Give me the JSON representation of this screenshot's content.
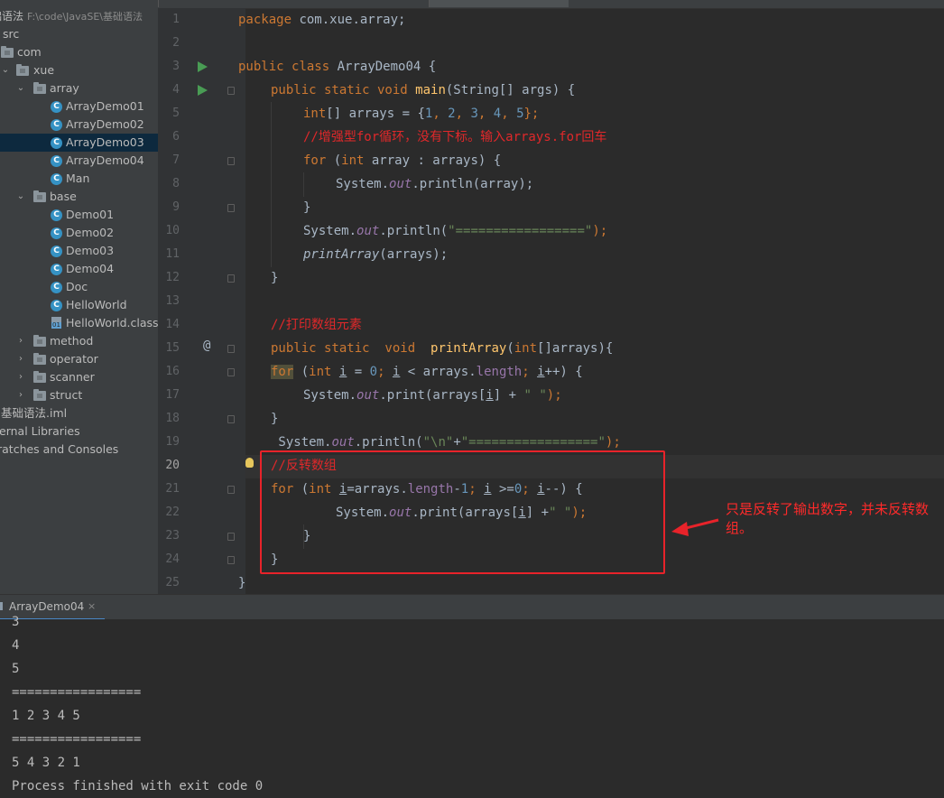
{
  "sidebar": {
    "root_name": "础语法",
    "root_path": "F:\\code\\JavaSE\\基础语法",
    "items": [
      {
        "label": "src",
        "kind": "text"
      },
      {
        "label": "com",
        "kind": "folder"
      },
      {
        "label": "xue",
        "kind": "folder",
        "expanded": true
      },
      {
        "label": "array",
        "kind": "folder",
        "expanded": true
      },
      {
        "label": "ArrayDemo01",
        "kind": "class"
      },
      {
        "label": "ArrayDemo02",
        "kind": "class"
      },
      {
        "label": "ArrayDemo03",
        "kind": "class",
        "selected": true
      },
      {
        "label": "ArrayDemo04",
        "kind": "class"
      },
      {
        "label": "Man",
        "kind": "class"
      },
      {
        "label": "base",
        "kind": "folder",
        "expanded": true
      },
      {
        "label": "Demo01",
        "kind": "class"
      },
      {
        "label": "Demo02",
        "kind": "class"
      },
      {
        "label": "Demo03",
        "kind": "class"
      },
      {
        "label": "Demo04",
        "kind": "class"
      },
      {
        "label": "Doc",
        "kind": "class"
      },
      {
        "label": "HelloWorld",
        "kind": "class"
      },
      {
        "label": "HelloWorld.class",
        "kind": "file"
      },
      {
        "label": "method",
        "kind": "folder",
        "expanded": false
      },
      {
        "label": "operator",
        "kind": "folder",
        "expanded": false
      },
      {
        "label": "scanner",
        "kind": "folder",
        "expanded": false
      },
      {
        "label": "struct",
        "kind": "folder",
        "expanded": false
      },
      {
        "label": "基础语法.iml",
        "kind": "text"
      },
      {
        "label": "ernal Libraries",
        "kind": "text"
      },
      {
        "label": "ratches and Consoles",
        "kind": "text"
      }
    ]
  },
  "editor": {
    "line_numbers": [
      "1",
      "2",
      "3",
      "4",
      "5",
      "6",
      "7",
      "8",
      "9",
      "10",
      "11",
      "12",
      "13",
      "14",
      "15",
      "16",
      "17",
      "18",
      "19",
      "20",
      "21",
      "22",
      "23",
      "24",
      "25"
    ],
    "current_line": "20",
    "code": {
      "l1_kw": "package",
      "l1_rest": " com.xue.array;",
      "l3_kw1": "public",
      "l3_kw2": "class",
      "l3_name": " ArrayDemo04 {",
      "l4_kw": "public static void",
      "l4_fn": "main",
      "l4_rest": "(String[] args) {",
      "l5_kw": "int",
      "l5_a": "[] arrays = {",
      "l5_n1": "1",
      "l5_n2": "2",
      "l5_n3": "3",
      "l5_n4": "4",
      "l5_n5": "5",
      "l5_comma": ", ",
      "l5_end": "};",
      "l6_cmt": "//增强型for循环，没有下标。输入arrays.for回车",
      "l7_kw1": "for",
      "l7_a": " (",
      "l7_kw2": "int",
      "l7_b": " array : arrays) {",
      "l8_a": "System.",
      "l8_out": "out",
      "l8_b": ".println(array);",
      "l9": "}",
      "l10_a": "System.",
      "l10_out": "out",
      "l10_b": ".println(",
      "l10_str": "\"=================\"",
      "l10_c": ");",
      "l11_fn": "printArray",
      "l11_rest": "(arrays);",
      "l12": "}",
      "l14_cmt": "//打印数组元素",
      "l15_kw1": "public static  void",
      "l15_fn": "printArray",
      "l15_a": "(",
      "l15_kw2": "int",
      "l15_b": "[]arrays){",
      "l16_kw1": "for",
      "l16_a": " (",
      "l16_kw2": "int",
      "l16_i": "i",
      "l16_b": " = ",
      "l16_zero": "0",
      "l16_c": "; ",
      "l16_i2": "i",
      "l16_d": " < arrays.",
      "l16_len": "length",
      "l16_e": "; ",
      "l16_i3": "i",
      "l16_f": "++) {",
      "l17_a": "System.",
      "l17_out": "out",
      "l17_b": ".print(arrays[",
      "l17_i": "i",
      "l17_c": "] + ",
      "l17_str": "\" \"",
      "l17_d": ");",
      "l18": "}",
      "l19_a": " System.",
      "l19_out": "out",
      "l19_b": ".println(",
      "l19_str1": "\"\\n\"",
      "l19_c": "+",
      "l19_str2": "\"=================\"",
      "l19_d": ");",
      "l20_cmt": "//反转数组",
      "l21_kw1": "for",
      "l21_a": " (",
      "l21_kw2": "int",
      "l21_i": "i",
      "l21_b": "=arrays.",
      "l21_len": "length",
      "l21_c": "-",
      "l21_one": "1",
      "l21_d": "; ",
      "l21_i2": "i",
      "l21_e": " >=",
      "l21_zero": "0",
      "l21_f": "; ",
      "l21_i3": "i",
      "l21_g": "--) {",
      "l22_a": "System.",
      "l22_out": "out",
      "l22_b": ".print(arrays[",
      "l22_i": "i",
      "l22_c": "] +",
      "l22_str": "\" \"",
      "l22_d": ");",
      "l23": "}",
      "l24": "}",
      "l25": "}"
    }
  },
  "annotation": {
    "text": "只是反转了输出数字，并未反转数组。",
    "color": "#e8232a"
  },
  "run_panel": {
    "tab_label": "ArrayDemo04",
    "tab_close": "×",
    "lines": [
      "3",
      "4",
      "5",
      "=================",
      "1 2 3 4 5",
      "=================",
      "5 4 3 2 1",
      "Process finished with exit code 0"
    ]
  },
  "colors": {
    "keyword": "#cc7832",
    "function": "#ffc66d",
    "number": "#6897bb",
    "string": "#6a8759",
    "comment": "#e0282a",
    "field": "#9876aa",
    "background": "#2b2b2b"
  }
}
